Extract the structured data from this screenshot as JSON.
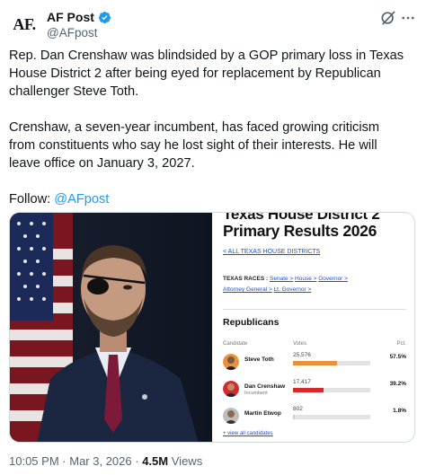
{
  "author": {
    "avatar_text": "AF.",
    "display_name": "AF Post",
    "handle": "@AFpost",
    "verified_color": "#1d9bf0"
  },
  "icons": {
    "grok": "grok-icon",
    "more": "more-icon"
  },
  "tweet": {
    "paragraph_1": "Rep. Dan Crenshaw was blindsided by a GOP primary loss in Texas House District 2 after being eyed for replacement by Republican challenger Steve Toth.",
    "paragraph_2": "Crenshaw, a seven-year incumbent, has faced growing criticism from constituents who say he lost sight of their interests. He will leave office on January 3, 2027.",
    "follow_label": "Follow:",
    "follow_mention": "@AFpost"
  },
  "graphic": {
    "title_cut": "Texas House District 2",
    "title": "Primary Results 2026",
    "all_races_link": "< ALL TEXAS HOUSE DISTRICTS",
    "races_label": "TEXAS RACES :",
    "races": [
      "Senate >",
      "House >",
      "Governor >",
      "Attorney General >",
      "Lt. Governor >"
    ],
    "party": "Republicans",
    "columns": {
      "candidate": "Candidate",
      "votes": "Votes",
      "pct": "Pct."
    },
    "candidates": [
      {
        "name": "Steve Toth",
        "sub": "",
        "votes": "25,576",
        "pct": "57.5%",
        "share": 0.575,
        "color": "#e8913a"
      },
      {
        "name": "Dan Crenshaw",
        "sub": "Incumbent",
        "votes": "17,417",
        "pct": "39.2%",
        "share": 0.392,
        "color": "#d42a2a"
      },
      {
        "name": "Martin Etwop",
        "sub": "",
        "votes": "802",
        "pct": "1.8%",
        "share": 0.018,
        "color": "#cfcfcf"
      }
    ],
    "view_all": "+ view all candidates"
  },
  "meta": {
    "time": "10:05 PM",
    "separator": "·",
    "date": "Mar 3, 2026",
    "views_count": "4.5M",
    "views_label": "Views"
  }
}
